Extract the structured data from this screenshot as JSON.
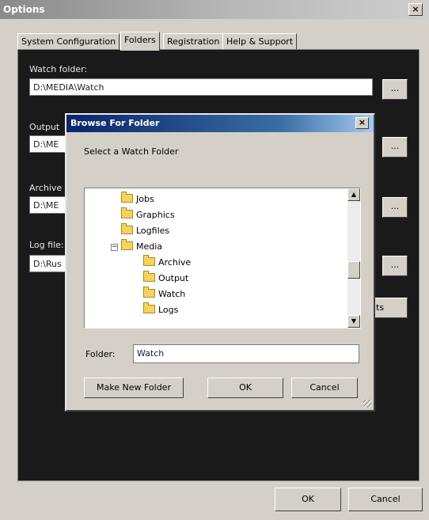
{
  "window": {
    "title": "Options",
    "close_glyph": "×"
  },
  "tabs": [
    {
      "label": "System Configuration",
      "active": false
    },
    {
      "label": "Folders",
      "active": true
    },
    {
      "label": "Registration",
      "active": false
    },
    {
      "label": "Help & Support",
      "active": false
    }
  ],
  "folders": {
    "watch_label": "Watch folder:",
    "watch_value": "D:\\MEDIA\\Watch",
    "output_label": "Output",
    "output_value": "D:\\ME",
    "archive_label": "Archive",
    "archive_value": "D:\\ME",
    "log_label": "Log file:",
    "log_value": "D:\\Rus",
    "browse_label": "...",
    "defaults_label_partial": "lts"
  },
  "footer": {
    "ok_label": "OK",
    "cancel_label": "Cancel"
  },
  "dialog": {
    "title": "Browse For Folder",
    "close_glyph": "×",
    "prompt": "Select a Watch Folder",
    "tree": [
      {
        "label": "Jobs",
        "level": 0
      },
      {
        "label": "Graphics",
        "level": 0
      },
      {
        "label": "Logfiles",
        "level": 0
      },
      {
        "label": "Media",
        "level": 0,
        "expander": "⊟"
      },
      {
        "label": "Archive",
        "level": 1
      },
      {
        "label": "Output",
        "level": 1
      },
      {
        "label": "Watch",
        "level": 1
      },
      {
        "label": "Logs",
        "level": 1
      }
    ],
    "folder_label": "Folder:",
    "folder_value": "Watch",
    "make_new_folder_label": "Make New Folder",
    "ok_label": "OK",
    "cancel_label": "Cancel"
  },
  "icons": {
    "folder": "folder-icon",
    "scroll_up": "▲",
    "scroll_down": "▼",
    "expander": "minus-box-icon"
  },
  "colors": {
    "panel_background": "#1a1a1a",
    "dialog_title_start": "#0a246a",
    "dialog_title_end": "#a6caf0",
    "folder_yellow": "#f4d35e"
  }
}
